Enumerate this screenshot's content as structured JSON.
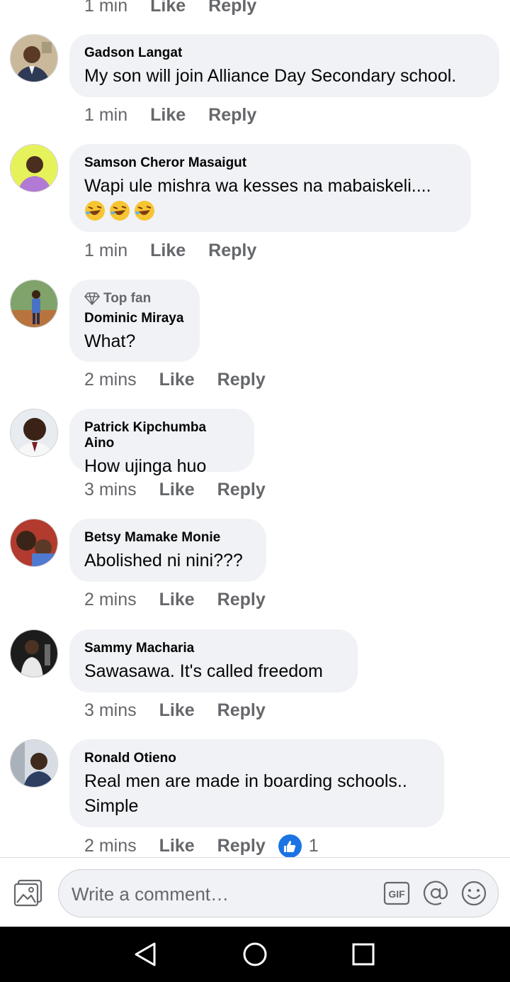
{
  "top_partial": {
    "time": "1 min",
    "like": "Like",
    "reply": "Reply"
  },
  "comments": [
    {
      "name": "Gadson Langat",
      "text": "My son will join Alliance Day Secondary school.",
      "time": "1 min",
      "like": "Like",
      "reply": "Reply"
    },
    {
      "name": "Samson Cheror Masaigut",
      "text": "Wapi ule mishra wa kesses na mabaiskeli....",
      "emoji": "rolling-on-floor-laughing x3",
      "time": "1 min",
      "like": "Like",
      "reply": "Reply"
    },
    {
      "badge": "Top fan",
      "name": "Dominic Miraya",
      "text": "What?",
      "time": "2 mins",
      "like": "Like",
      "reply": "Reply"
    },
    {
      "name": "Patrick Kipchumba Aino",
      "text": "How ujinga huo",
      "time": "3 mins",
      "like": "Like",
      "reply": "Reply"
    },
    {
      "name": "Betsy Mamake Monie",
      "text": "Abolished ni nini???",
      "time": "2 mins",
      "like": "Like",
      "reply": "Reply"
    },
    {
      "name": "Sammy Macharia",
      "text": "Sawasawa. It's called freedom",
      "time": "3 mins",
      "like": "Like",
      "reply": "Reply"
    },
    {
      "name": "Ronald Otieno",
      "text_line1": "Real men are made in boarding schools..",
      "text_line2": "Simple",
      "time": "2 mins",
      "like": "Like",
      "reply": "Reply",
      "reaction_count": "1"
    }
  ],
  "composer": {
    "placeholder": "Write a comment…",
    "icons": [
      "photo-icon",
      "gif-icon",
      "mention-icon",
      "emoji-icon"
    ]
  },
  "navbar": {
    "icons": [
      "back-icon",
      "home-icon",
      "recents-icon"
    ]
  },
  "colors": {
    "bubble": "#f0f2f5",
    "meta": "#65676b",
    "like_blue": "#1b74e4"
  }
}
